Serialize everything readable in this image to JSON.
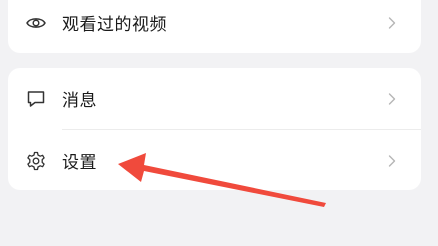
{
  "menu": {
    "top_items": [
      {
        "label": "观看过的视频",
        "icon": "eye-icon"
      }
    ],
    "bottom_items": [
      {
        "label": "消息",
        "icon": "message-icon"
      },
      {
        "label": "设置",
        "icon": "gear-icon"
      }
    ]
  },
  "colors": {
    "background": "#f2f2f4",
    "card": "#ffffff",
    "text": "#1a1a1a",
    "chevron": "#b5b5b5",
    "annotation_arrow": "#f04a3c"
  }
}
